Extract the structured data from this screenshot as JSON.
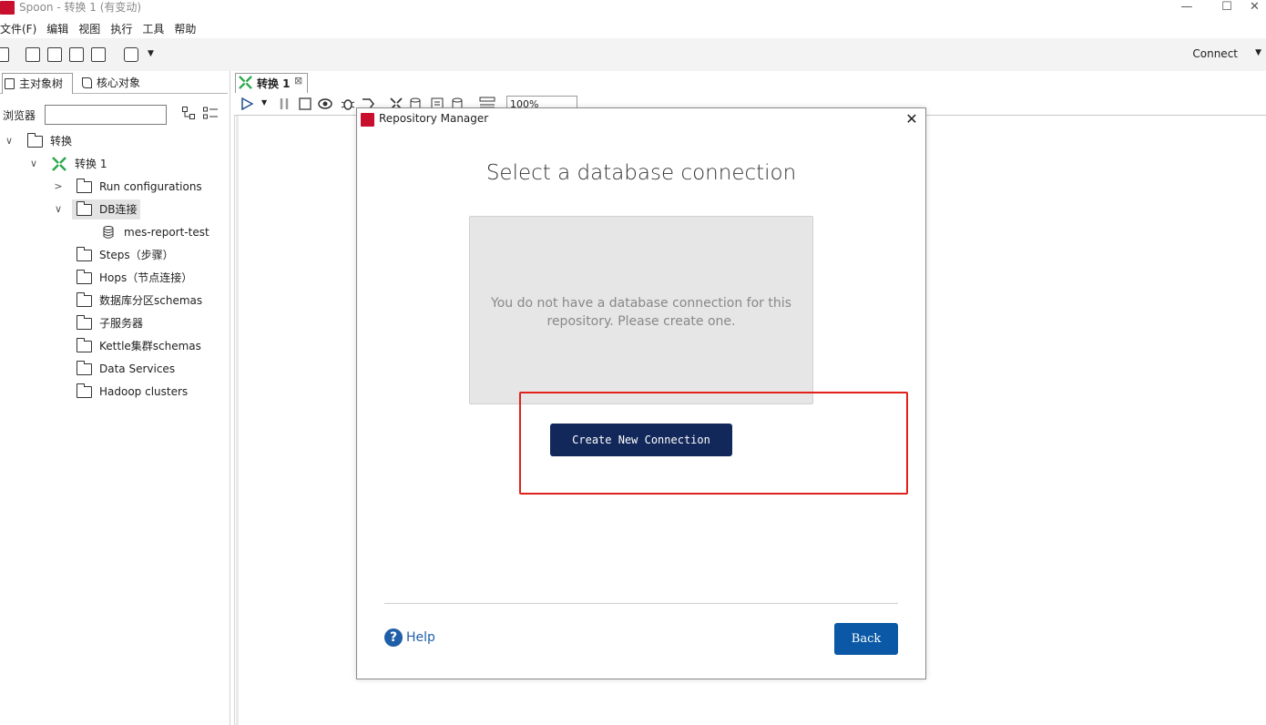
{
  "window": {
    "title": "Spoon - 转换 1 (有变动)",
    "controls": [
      "—",
      "☐",
      "✕"
    ]
  },
  "menu": [
    "文件(F)",
    "编辑",
    "视图",
    "执行",
    "工具",
    "帮助"
  ],
  "toolbar": {
    "connect_label": "Connect",
    "connect_caret": "▼"
  },
  "left_panel": {
    "tabs": [
      "主对象树",
      "核心对象"
    ],
    "browse_label": "浏览器",
    "search_value": "",
    "tree": [
      {
        "label": "转换",
        "chevron": "∨",
        "type": "folder"
      },
      {
        "label": "转换 1",
        "chevron": "∨",
        "type": "transform"
      },
      {
        "label": "Run configurations",
        "chevron": ">",
        "type": "folder"
      },
      {
        "label": "DB连接",
        "chevron": "∨",
        "type": "folder",
        "selected": true
      },
      {
        "label": "mes-report-test",
        "chevron": "",
        "type": "database"
      },
      {
        "label": "Steps（步骤）",
        "chevron": "",
        "type": "folder"
      },
      {
        "label": "Hops（节点连接）",
        "chevron": "",
        "type": "folder"
      },
      {
        "label": "数据库分区schemas",
        "chevron": "",
        "type": "folder"
      },
      {
        "label": "子服务器",
        "chevron": "",
        "type": "folder"
      },
      {
        "label": "Kettle集群schemas",
        "chevron": "",
        "type": "folder"
      },
      {
        "label": "Data Services",
        "chevron": "",
        "type": "folder"
      },
      {
        "label": "Hadoop clusters",
        "chevron": "",
        "type": "folder"
      }
    ]
  },
  "editor": {
    "tab_label": "转换 1",
    "tab_close": "⊠",
    "zoom": "100%"
  },
  "dialog": {
    "title": "Repository Manager",
    "close": "✕",
    "heading": "Select a database connection",
    "empty_message": "You do not have a database connection for this repository. Please create one.",
    "create_button": "Create New Connection",
    "help_icon": "?",
    "help_label": "Help",
    "back_button": "Back"
  },
  "colors": {
    "brand_red": "#c8102e",
    "create_button_bg": "#12285a",
    "back_button_bg": "#0b59a6",
    "highlight_border": "#e0211c",
    "help_blue": "#1f5fa8"
  }
}
